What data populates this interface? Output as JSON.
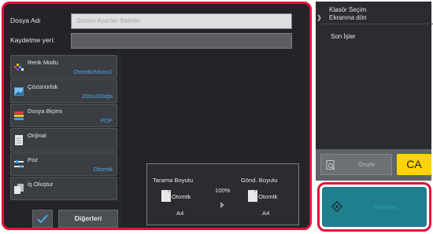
{
  "fields": {
    "file_name": {
      "label": "Dosya Adı",
      "placeholder": "Sistem Ayarları Belirler"
    },
    "save_location": {
      "label": "Kaydetme yeri:",
      "value": ""
    }
  },
  "modes": [
    {
      "label": "Renk Modu",
      "value": "Otomtk/Mono2",
      "icon": "color-mode-icon"
    },
    {
      "label": "Çözünürlük",
      "value": "200x200dpi",
      "icon": "resolution-icon"
    },
    {
      "label": "Dosya Biçimi",
      "value": "PDF",
      "icon": "file-format-icon"
    },
    {
      "label": "Orijinal",
      "value": "",
      "icon": "original-icon"
    },
    {
      "label": "Poz",
      "value": "Otomtk",
      "icon": "exposure-icon"
    },
    {
      "label": "İş Oluştur",
      "value": "",
      "icon": "job-build-icon"
    }
  ],
  "summary": {
    "scan_size_label": "Tarama Boyutu",
    "send_size_label": "Gönd. Boyutu",
    "scan_mode": "Otomtk",
    "send_mode": "Otomtk",
    "scan_paper": "A4",
    "send_paper": "A4",
    "ratio": "100%"
  },
  "bottom_left": {
    "others_label": "Diğerleri"
  },
  "right_panel": {
    "folder_line1": "Klasör Seçim",
    "folder_line2": "Ekranına dön",
    "recent_jobs": "Son İşler"
  },
  "buttons": {
    "preview_label": "Önizle",
    "ca_label": "CA",
    "start_label": "Başlama"
  },
  "colors": {
    "highlight": "#e0123a",
    "accent_blue": "#4aa6e6",
    "ca_yellow": "#ffd400",
    "start_teal": "#1f7f8c"
  }
}
